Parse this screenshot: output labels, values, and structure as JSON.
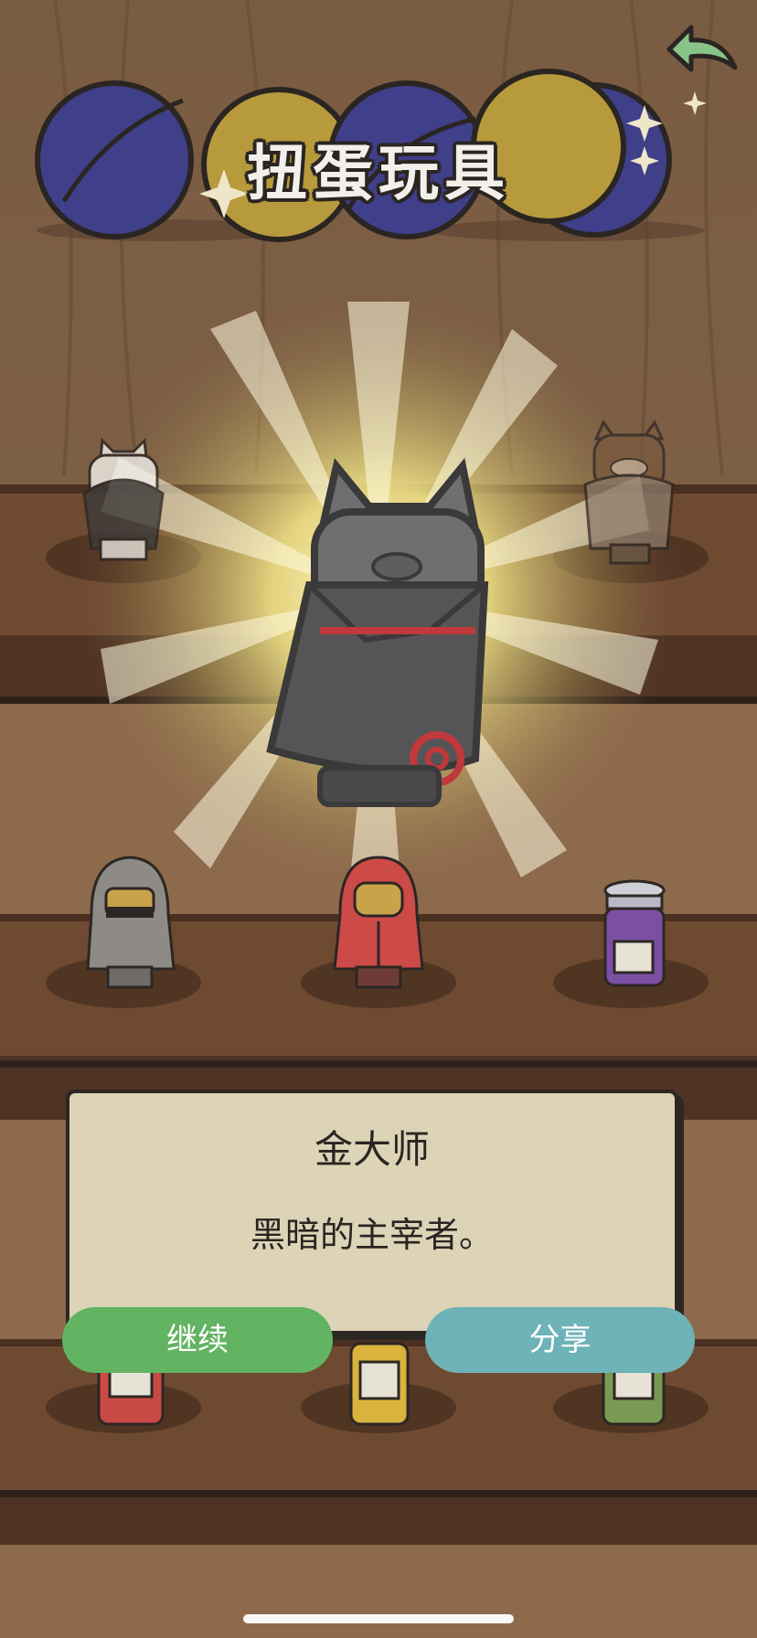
{
  "header": {
    "title": "扭蛋玩具"
  },
  "icons": {
    "back": "back-arrow-icon",
    "sparkle": "sparkle-icon"
  },
  "prize": {
    "name": "金大师",
    "description": "黑暗的主宰者。"
  },
  "buttons": {
    "continue_label": "继续",
    "share_label": "分享"
  },
  "colors": {
    "continue_button": "#62b362",
    "share_button": "#6db3b7",
    "dialog_background": "#ddd4b7",
    "capsule_blue": "#3f3f8a",
    "capsule_yellow": "#b79a3c"
  }
}
